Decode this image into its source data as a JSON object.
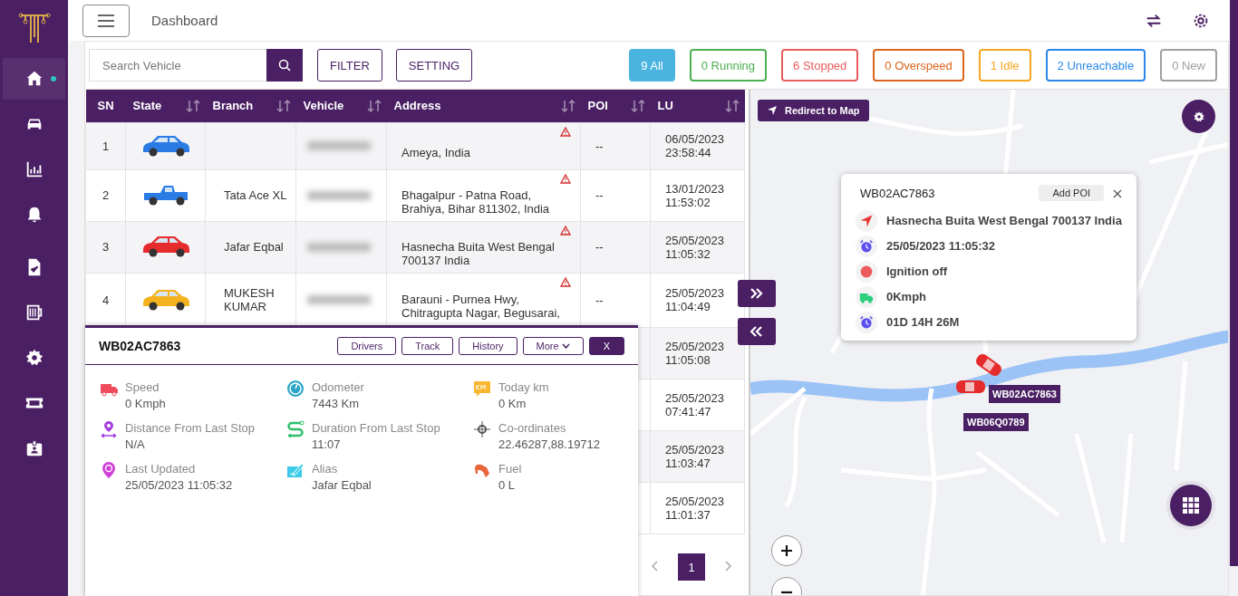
{
  "sidebar": {
    "items": [
      {
        "selected": true,
        "indicator": true
      },
      {
        "selected": false,
        "indicator": false
      },
      {
        "selected": false,
        "indicator": false
      },
      {
        "selected": false,
        "indicator": false
      },
      {
        "selected": false,
        "indicator": false
      },
      {
        "selected": false,
        "indicator": false
      },
      {
        "selected": false,
        "indicator": false
      },
      {
        "selected": false,
        "indicator": false
      },
      {
        "selected": false,
        "indicator": false
      }
    ]
  },
  "topbar": {
    "title": "Dashboard"
  },
  "toolbar": {
    "search": {
      "placeholder": "Search Vehicle"
    },
    "buttons": [
      "FILTER",
      "SETTING"
    ],
    "status_filters": [
      {
        "label": "9 All",
        "color": "#4bb3e0",
        "selected": true
      },
      {
        "label": "0 Running",
        "color": "#4caf50",
        "selected": false
      },
      {
        "label": "6 Stopped",
        "color": "#e85c5c",
        "selected": false
      },
      {
        "label": "0 Overspeed",
        "color": "#d9651e",
        "selected": false
      },
      {
        "label": "1 Idle",
        "color": "#f5a623",
        "selected": false
      },
      {
        "label": "2 Unreachable",
        "color": "#2b88e6",
        "selected": false
      },
      {
        "label": "0 New",
        "color": "#a0a0a0",
        "selected": false
      }
    ]
  },
  "table": {
    "columns": [
      {
        "label": "SN",
        "sortable": false
      },
      {
        "label": "State",
        "sortable": true
      },
      {
        "label": "Branch",
        "sortable": true
      },
      {
        "label": "Vehicle",
        "sortable": true
      },
      {
        "label": "Address",
        "sortable": true
      },
      {
        "label": "POI",
        "sortable": true
      },
      {
        "label": "LU",
        "sortable": true
      }
    ],
    "rows": [
      {
        "sn": "1",
        "kind": "car",
        "color": "#2b7be4",
        "branch": "",
        "address": "Ameya, India",
        "alert": true,
        "poi": "--",
        "lu": "06/05/2023 23:58:44"
      },
      {
        "sn": "2",
        "kind": "pickup",
        "color": "#2b7be4",
        "branch": "Tata Ace XL",
        "address": "Bhagalpur - Patna Road, Brahiya, Bihar 811302, India",
        "alert": true,
        "poi": "--",
        "lu": "13/01/2023 11:53:02"
      },
      {
        "sn": "3",
        "kind": "car",
        "color": "#e52b2b",
        "branch": "Jafar Eqbal",
        "address": "Hasnecha Buita West Bengal 700137 India",
        "alert": true,
        "poi": "--",
        "lu": "25/05/2023 11:05:32"
      },
      {
        "sn": "4",
        "kind": "car",
        "color": "#f5b21f",
        "branch": "MUKESH KUMAR",
        "address": "Barauni - Purnea Hwy, Chitragupta Nagar, Begusarai,",
        "alert": true,
        "poi": "--",
        "lu": "25/05/2023 11:04:49"
      },
      {
        "lu": "25/05/2023 11:05:08"
      },
      {
        "lu": "25/05/2023 07:41:47"
      },
      {
        "lu": "25/05/2023 11:03:47"
      },
      {
        "lu": "25/05/2023 11:01:37"
      }
    ],
    "pagination": {
      "pages": [
        {
          "label": "1",
          "selected": true
        }
      ]
    }
  },
  "detail_panel": {
    "title": "WB02AC7863",
    "buttons": [
      "Drivers",
      "Track",
      "History",
      "More"
    ],
    "close": "X",
    "fields": [
      {
        "label": "Speed",
        "value": "0 Kmph"
      },
      {
        "label": "Odometer",
        "value": "7443 Km"
      },
      {
        "label": "Today km",
        "value": "0 Km"
      },
      {
        "label": "Distance From Last Stop",
        "value": "N/A"
      },
      {
        "label": "Duration From Last Stop",
        "value": "11:07"
      },
      {
        "label": "Co-ordinates",
        "value": "22.46287,88.19712"
      },
      {
        "label": "Last Updated",
        "value": "25/05/2023 11:05:32"
      },
      {
        "label": "Alias",
        "value": "Jafar Eqbal"
      },
      {
        "label": "Fuel",
        "value": "0 L"
      }
    ]
  },
  "map": {
    "redirect_button": "Redirect to Map",
    "popup": {
      "title": "WB02AC7863",
      "button": "Add POI",
      "rows": [
        "Hasnecha Buita West Bengal 700137 India",
        "25/05/2023 11:05:32",
        "Ignition off",
        "0Kmph",
        "01D 14H 26M"
      ]
    },
    "markers": [
      {
        "label": "WB02AC7863"
      },
      {
        "label": "WB06Q0789"
      }
    ]
  }
}
